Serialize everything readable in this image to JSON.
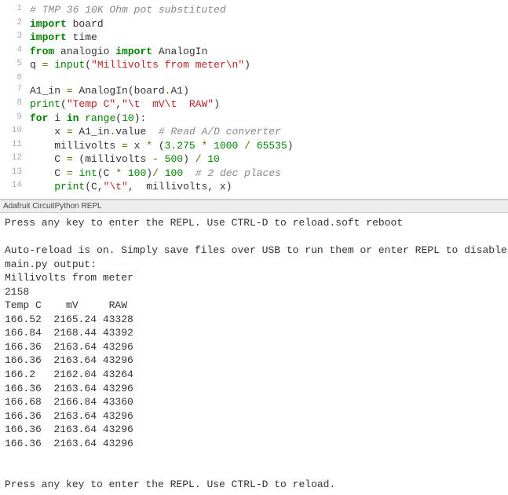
{
  "editor": {
    "lines": [
      {
        "n": "1",
        "tokens": [
          {
            "cls": "com",
            "t": "# TMP 36 10K Ohm pot substituted"
          }
        ]
      },
      {
        "n": "2",
        "tokens": [
          {
            "cls": "kw",
            "t": "import"
          },
          {
            "cls": "",
            "t": " board"
          }
        ]
      },
      {
        "n": "3",
        "tokens": [
          {
            "cls": "kw",
            "t": "import"
          },
          {
            "cls": "",
            "t": " time"
          }
        ]
      },
      {
        "n": "4",
        "tokens": [
          {
            "cls": "kw",
            "t": "from"
          },
          {
            "cls": "",
            "t": " analogio "
          },
          {
            "cls": "kw",
            "t": "import"
          },
          {
            "cls": "",
            "t": " AnalogIn"
          }
        ]
      },
      {
        "n": "5",
        "tokens": [
          {
            "cls": "",
            "t": "q "
          },
          {
            "cls": "op",
            "t": "="
          },
          {
            "cls": "",
            "t": " "
          },
          {
            "cls": "builtin",
            "t": "input"
          },
          {
            "cls": "",
            "t": "("
          },
          {
            "cls": "str",
            "t": "\"Millivolts from meter\\n\""
          },
          {
            "cls": "",
            "t": ")"
          }
        ]
      },
      {
        "n": "6",
        "tokens": [
          {
            "cls": "",
            "t": ""
          }
        ]
      },
      {
        "n": "7",
        "tokens": [
          {
            "cls": "",
            "t": "A1_in "
          },
          {
            "cls": "op",
            "t": "="
          },
          {
            "cls": "",
            "t": " AnalogIn(board"
          },
          {
            "cls": "op",
            "t": "."
          },
          {
            "cls": "",
            "t": "A1)"
          }
        ]
      },
      {
        "n": "8",
        "tokens": [
          {
            "cls": "builtin",
            "t": "print"
          },
          {
            "cls": "",
            "t": "("
          },
          {
            "cls": "str",
            "t": "\"Temp C\""
          },
          {
            "cls": "",
            "t": ","
          },
          {
            "cls": "str",
            "t": "\"\\t  mV\\t  RAW\""
          },
          {
            "cls": "",
            "t": ")"
          }
        ]
      },
      {
        "n": "9",
        "tokens": [
          {
            "cls": "kw",
            "t": "for"
          },
          {
            "cls": "",
            "t": " i "
          },
          {
            "cls": "kw",
            "t": "in"
          },
          {
            "cls": "",
            "t": " "
          },
          {
            "cls": "builtin",
            "t": "range"
          },
          {
            "cls": "",
            "t": "("
          },
          {
            "cls": "num",
            "t": "10"
          },
          {
            "cls": "",
            "t": "):"
          }
        ]
      },
      {
        "n": "10",
        "tokens": [
          {
            "cls": "",
            "t": "    x "
          },
          {
            "cls": "op",
            "t": "="
          },
          {
            "cls": "",
            "t": " A1_in"
          },
          {
            "cls": "op",
            "t": "."
          },
          {
            "cls": "",
            "t": "value  "
          },
          {
            "cls": "com",
            "t": "# Read A/D converter"
          }
        ]
      },
      {
        "n": "11",
        "tokens": [
          {
            "cls": "",
            "t": "    millivolts "
          },
          {
            "cls": "op",
            "t": "="
          },
          {
            "cls": "",
            "t": " x "
          },
          {
            "cls": "op",
            "t": "*"
          },
          {
            "cls": "",
            "t": " ("
          },
          {
            "cls": "num",
            "t": "3.275"
          },
          {
            "cls": "",
            "t": " "
          },
          {
            "cls": "op",
            "t": "*"
          },
          {
            "cls": "",
            "t": " "
          },
          {
            "cls": "num",
            "t": "1000"
          },
          {
            "cls": "",
            "t": " "
          },
          {
            "cls": "op",
            "t": "/"
          },
          {
            "cls": "",
            "t": " "
          },
          {
            "cls": "num",
            "t": "65535"
          },
          {
            "cls": "",
            "t": ")"
          }
        ]
      },
      {
        "n": "12",
        "tokens": [
          {
            "cls": "",
            "t": "    C "
          },
          {
            "cls": "op",
            "t": "="
          },
          {
            "cls": "",
            "t": " (millivolts "
          },
          {
            "cls": "op",
            "t": "-"
          },
          {
            "cls": "",
            "t": " "
          },
          {
            "cls": "num",
            "t": "500"
          },
          {
            "cls": "",
            "t": ") "
          },
          {
            "cls": "op",
            "t": "/"
          },
          {
            "cls": "",
            "t": " "
          },
          {
            "cls": "num",
            "t": "10"
          }
        ]
      },
      {
        "n": "13",
        "tokens": [
          {
            "cls": "",
            "t": "    C "
          },
          {
            "cls": "op",
            "t": "="
          },
          {
            "cls": "",
            "t": " "
          },
          {
            "cls": "builtin",
            "t": "int"
          },
          {
            "cls": "",
            "t": "(C "
          },
          {
            "cls": "op",
            "t": "*"
          },
          {
            "cls": "",
            "t": " "
          },
          {
            "cls": "num",
            "t": "100"
          },
          {
            "cls": "",
            "t": ")"
          },
          {
            "cls": "op",
            "t": "/"
          },
          {
            "cls": "",
            "t": " "
          },
          {
            "cls": "num",
            "t": "100"
          },
          {
            "cls": "",
            "t": "  "
          },
          {
            "cls": "com",
            "t": "# 2 dec places"
          }
        ]
      },
      {
        "n": "14",
        "tokens": [
          {
            "cls": "",
            "t": "    "
          },
          {
            "cls": "builtin",
            "t": "print"
          },
          {
            "cls": "",
            "t": "(C,"
          },
          {
            "cls": "str",
            "t": "\"\\t\""
          },
          {
            "cls": "",
            "t": ",  millivolts, x)"
          }
        ]
      }
    ]
  },
  "panel_header": "Adafruit CircuitPython REPL",
  "repl": {
    "lines": [
      "Press any key to enter the REPL. Use CTRL-D to reload.soft reboot",
      "",
      "Auto-reload is on. Simply save files over USB to run them or enter REPL to disable.",
      "main.py output:",
      "Millivolts from meter",
      "2158",
      "Temp C    mV     RAW",
      "166.52  2165.24 43328",
      "166.84  2168.44 43392",
      "166.36  2163.64 43296",
      "166.36  2163.64 43296",
      "166.2   2162.04 43264",
      "166.36  2163.64 43296",
      "166.68  2166.84 43360",
      "166.36  2163.64 43296",
      "166.36  2163.64 43296",
      "166.36  2163.64 43296",
      "",
      "",
      "Press any key to enter the REPL. Use CTRL-D to reload."
    ]
  }
}
